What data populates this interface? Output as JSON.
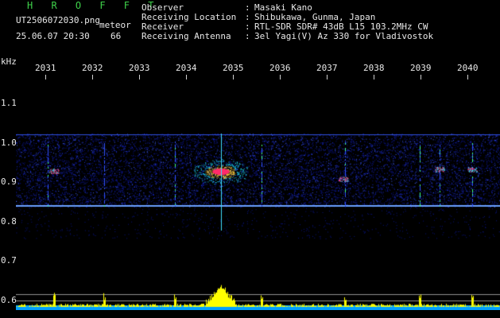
{
  "station": {
    "name": "H R O F F T",
    "filename": "UT2506072030.png",
    "mode": "meteor",
    "datetime": "25.06.07 20:30",
    "count": "66"
  },
  "info": [
    {
      "label": "Observer",
      "value": "Masaki Kano"
    },
    {
      "label": "Receiving Location",
      "value": "Shibukawa, Gunma, Japan"
    },
    {
      "label": "Receiver",
      "value": "RTL-SDR SDR# 43dB L15 103.2MHz CW"
    },
    {
      "label": "Receiving Antenna",
      "value": "3el Yagi(V) Az 330 for Vladivostok"
    }
  ],
  "axes": {
    "freq_unit": "kHz",
    "freq_ticks": [
      "1.1",
      "1.0",
      "0.9",
      "0.8",
      "0.7",
      "0.6"
    ],
    "time_ticks": [
      "2031",
      "2032",
      "2033",
      "2034",
      "2035",
      "2036",
      "2037",
      "2038",
      "2039",
      "2040"
    ]
  },
  "colors": {
    "background": "#000000",
    "noise_band": "#1a2bd0",
    "carrier_line": "#6aa0ff",
    "echo_core": "#ff2a6a",
    "echo_halo": "#20e0ff",
    "bottom_signal": "#ffff00",
    "bottom_base": "#00a0ff"
  }
}
